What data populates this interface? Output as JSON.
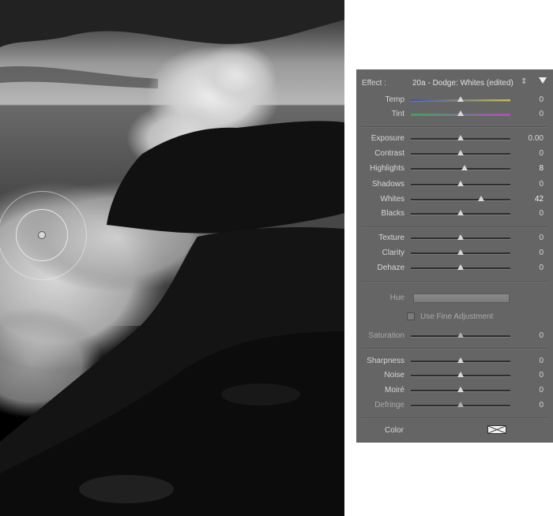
{
  "effect": {
    "label": "Effect :",
    "preset": "20a - Dodge: Whites (edited)",
    "arrows": "⇕"
  },
  "sliders": {
    "temp": {
      "label": "Temp",
      "value": "0",
      "level": 0.5
    },
    "tint": {
      "label": "Tint",
      "value": "0",
      "level": 0.5
    },
    "exposure": {
      "label": "Exposure",
      "value": "0.00",
      "level": 0.5
    },
    "contrast": {
      "label": "Contrast",
      "value": "0",
      "level": 0.5
    },
    "highlights": {
      "label": "Highlights",
      "value": "8",
      "level": 0.54
    },
    "shadows": {
      "label": "Shadows",
      "value": "0",
      "level": 0.5
    },
    "whites": {
      "label": "Whites",
      "value": "42",
      "level": 0.71
    },
    "blacks": {
      "label": "Blacks",
      "value": "0",
      "level": 0.5
    },
    "texture": {
      "label": "Texture",
      "value": "0",
      "level": 0.5
    },
    "clarity": {
      "label": "Clarity",
      "value": "0",
      "level": 0.5
    },
    "dehaze": {
      "label": "Dehaze",
      "value": "0",
      "level": 0.5
    },
    "saturation": {
      "label": "Saturation",
      "value": "0",
      "level": 0.5
    },
    "sharpness": {
      "label": "Sharpness",
      "value": "0",
      "level": 0.5
    },
    "noise": {
      "label": "Noise",
      "value": "0",
      "level": 0.5
    },
    "moire": {
      "label": "Moiré",
      "value": "0",
      "level": 0.5
    },
    "defringe": {
      "label": "Defringe",
      "value": "0",
      "level": 0.5
    }
  },
  "hue": {
    "label": "Hue"
  },
  "fine_adjustment": {
    "label": "Use Fine Adjustment",
    "checked": false
  },
  "color": {
    "label": "Color"
  },
  "colors": {
    "panel_bg": "#656565",
    "temp_track": [
      "#3c4fb4",
      "#c9c24a"
    ],
    "tint_track": [
      "#3fa35a",
      "#b24bbd"
    ]
  }
}
